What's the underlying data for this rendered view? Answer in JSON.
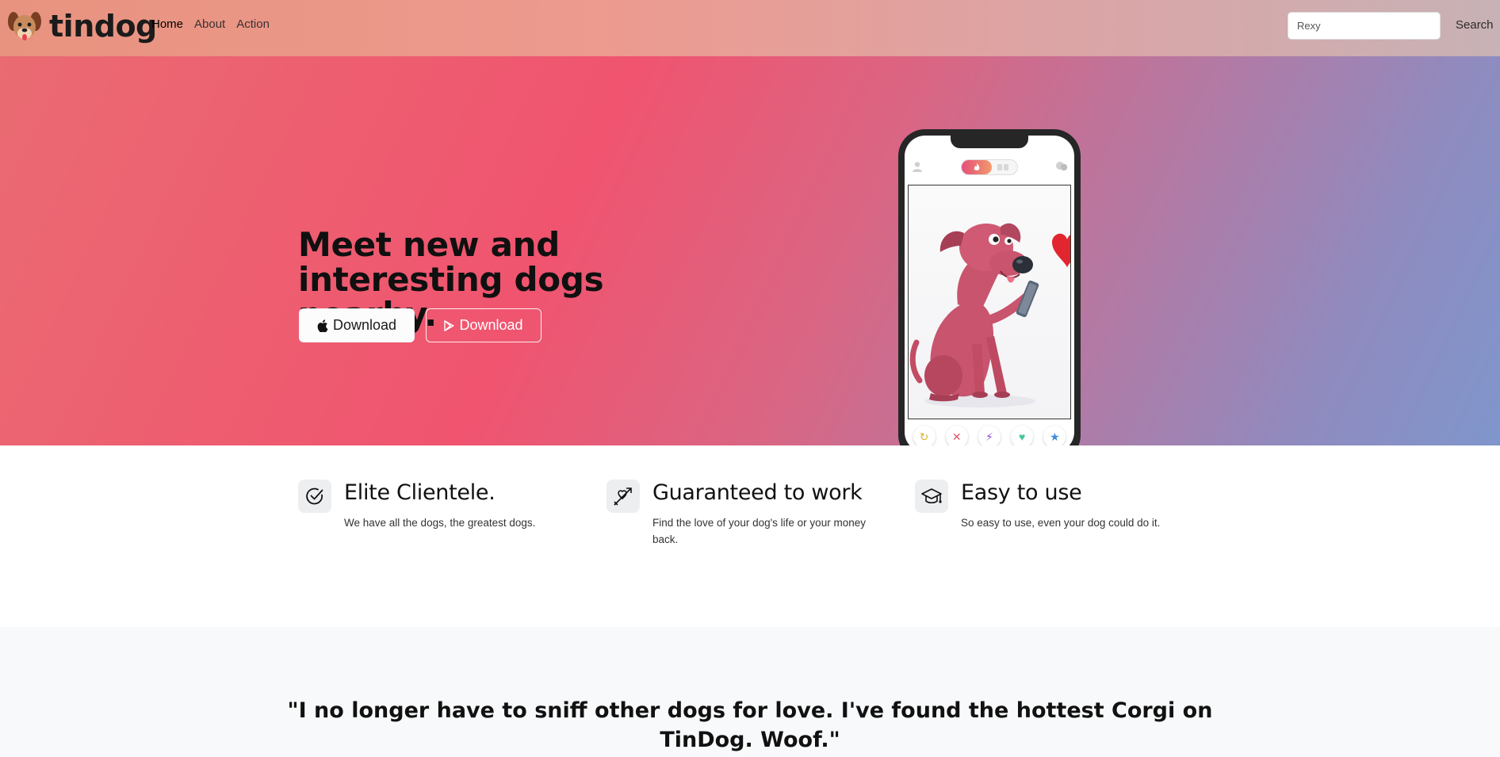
{
  "brand": {
    "name": "tindog",
    "logo_icon": "dog-face-icon"
  },
  "nav": {
    "items": [
      {
        "label": "Home",
        "active": true
      },
      {
        "label": "About",
        "active": false
      },
      {
        "label": "Action",
        "active": false
      }
    ]
  },
  "search": {
    "value": "Rexy",
    "button_label": "Search"
  },
  "hero": {
    "title": "Meet new and interesting dogs nearby.",
    "buttons": [
      {
        "label": "Download",
        "icon": "apple-icon"
      },
      {
        "label": "Download",
        "icon": "google-play-icon"
      }
    ],
    "phone": {
      "actions": [
        "rewind-icon",
        "close-icon",
        "boost-icon",
        "heart-icon",
        "star-icon"
      ]
    }
  },
  "features": [
    {
      "icon": "check-circle-icon",
      "title": "Elite Clientele.",
      "text": "We have all the dogs, the greatest dogs."
    },
    {
      "icon": "heart-arrow-icon",
      "title": "Guaranteed to work",
      "text": "Find the love of your dog's life or your money back."
    },
    {
      "icon": "graduation-cap-icon",
      "title": "Easy to use",
      "text": "So easy to use, even your dog could do it."
    }
  ],
  "testimonial": {
    "quote": "\"I no longer have to sniff other dogs for love. I've found the hottest Corgi on TinDog. Woof.\""
  },
  "colors": {
    "navbar_gradient": [
      "#e8937f",
      "#c7b2b5"
    ],
    "hero_gradient": [
      "#ea6b72",
      "#f0546f",
      "#b07ba6",
      "#7f96cc"
    ],
    "testimonial_bg": "#f8f9fa"
  }
}
